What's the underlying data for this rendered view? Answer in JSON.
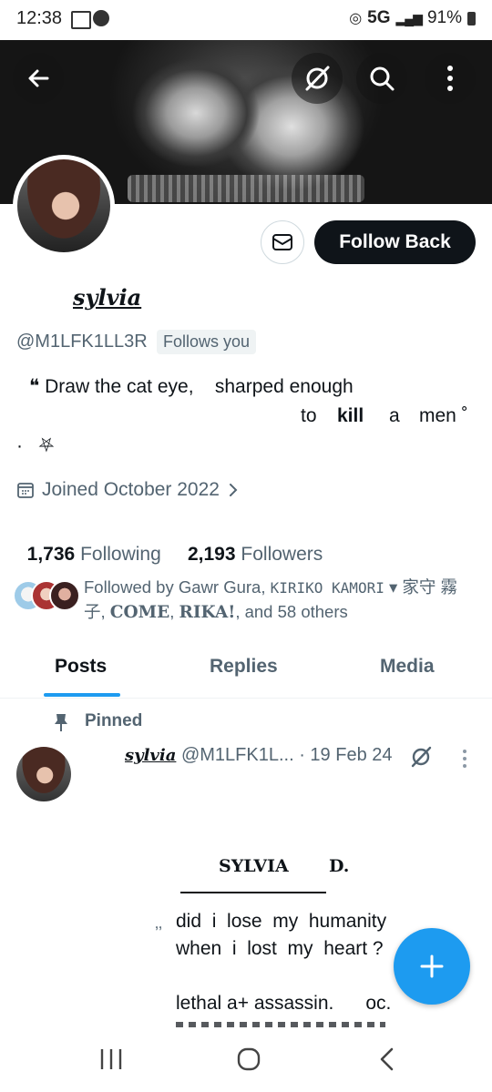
{
  "status_bar": {
    "time": "12:38",
    "network": "5G",
    "battery": "91%"
  },
  "profile": {
    "display_name": "sylvia",
    "handle": "@M1LFK1LL3R",
    "follows_you": "Follows you",
    "bio_line1": "❝ Draw the cat eye,    sharped enough",
    "bio_to": "to",
    "bio_kill": "kill",
    "bio_a": "a",
    "bio_men": "men ˚",
    "bio_line3": "·   ⛧",
    "joined": "Joined October 2022",
    "following_count": "1,736",
    "following_label": "Following",
    "followers_count": "2,193",
    "followers_label": "Followers",
    "followed_by_prefix": "Followed by Gawr Gura, ",
    "followed_by_kiriko": "KIRIKO KAMORI",
    "followed_by_mid": " ▾ 家守 霧子, ",
    "followed_by_come": "COME",
    "followed_by_sep": ", ",
    "followed_by_rika": "RIKA!",
    "followed_by_suffix": ", and 58 others"
  },
  "buttons": {
    "follow_back": "Follow Back"
  },
  "tabs": [
    {
      "label": "Posts"
    },
    {
      "label": "Replies"
    },
    {
      "label": "Media"
    }
  ],
  "pinned_post": {
    "pinned_label": "Pinned",
    "author_name": "sylvia",
    "author_handle": "@M1LFK1L...",
    "date": "· 19 Feb 24",
    "title_left": "SYLVIA",
    "title_right": "D.",
    "quote_mark": "‚‚",
    "line1": "did  i  lose  my  humanity",
    "line2": "when  i  lost  my  heart ?",
    "line3": "lethal a+ assassin.      oc."
  },
  "colors": {
    "accent": "#1d9bf0",
    "text": "#0f1419",
    "muted": "#536471"
  },
  "icons": [
    "back-arrow-icon",
    "grok-icon",
    "search-icon",
    "more-vertical-icon",
    "mail-icon",
    "calendar-icon",
    "chevron-right-icon",
    "pin-icon",
    "plus-icon"
  ]
}
